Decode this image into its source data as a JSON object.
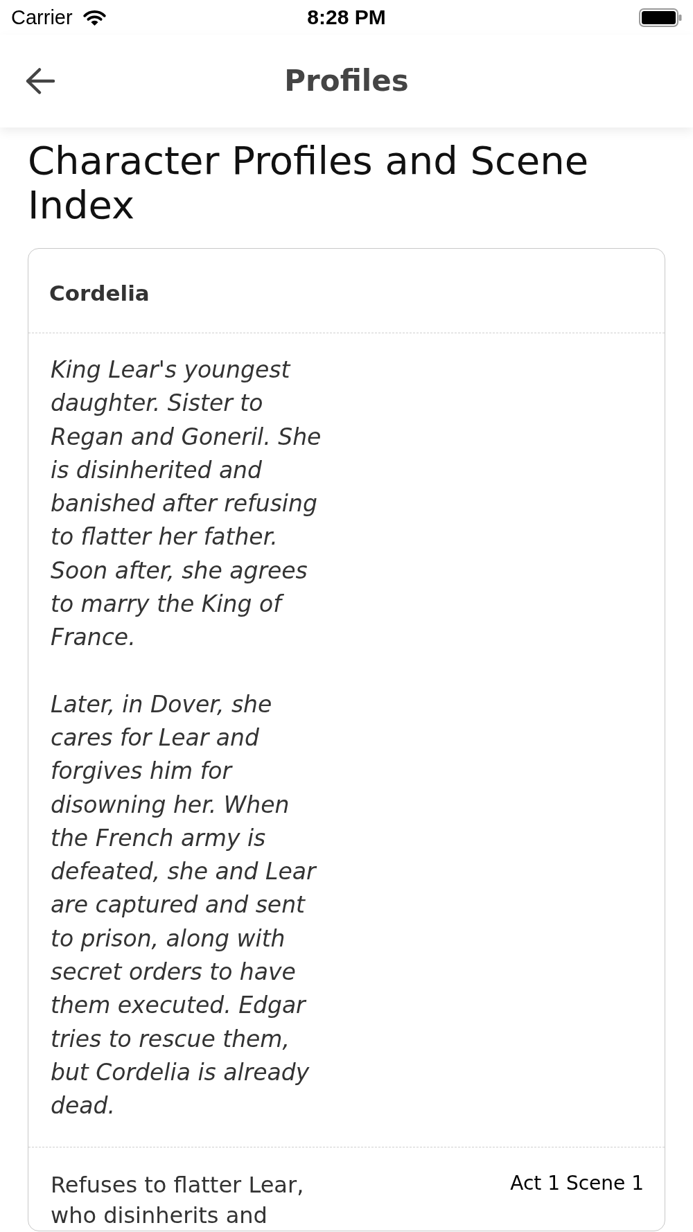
{
  "status_bar": {
    "carrier": "Carrier",
    "time": "8:28 PM"
  },
  "nav_bar": {
    "title": "Profiles"
  },
  "page_title": "Character Profiles and Scene Index",
  "profiles": [
    {
      "name": "Cordelia",
      "description": [
        "King Lear's youngest daughter. Sister to Regan and Goneril. She is disinherited and banished after refusing to flatter her father. Soon after, she agrees to marry the King of France.",
        "Later, in Dover, she cares for Lear and forgives him for disowning her. When the French army is defeated, she and Lear are captured and sent to prison, along with secret orders to have them executed. Edgar tries to rescue them, but Cordelia is already dead."
      ],
      "scenes": [
        {
          "summary": "Refuses to flatter Lear, who disinherits and",
          "reference": "Act 1 Scene 1"
        }
      ]
    }
  ]
}
